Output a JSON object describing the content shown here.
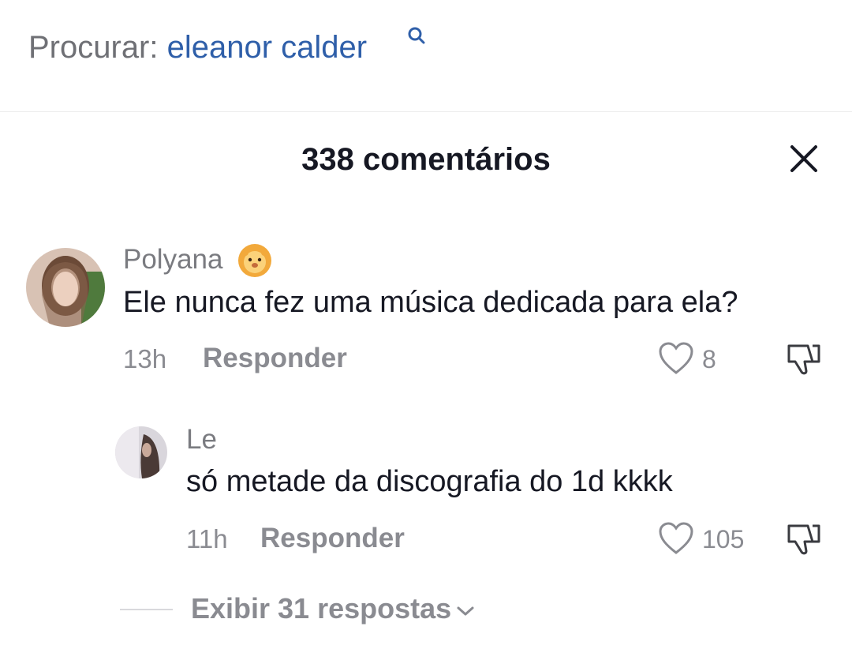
{
  "search": {
    "prefix": "Procurar: ",
    "query": "eleanor calder"
  },
  "comments_panel": {
    "title": "338 comentários"
  },
  "comments": [
    {
      "username": "Polyana",
      "emoji": "lion-face-icon",
      "text": "Ele nunca fez uma música dedicada para ela?",
      "time": "13h",
      "reply_label": "Responder",
      "likes": "8"
    }
  ],
  "replies": [
    {
      "username": "Le",
      "text": "só metade da discografia do 1d kkkk",
      "time": "11h",
      "reply_label": "Responder",
      "likes": "105"
    }
  ],
  "view_replies_label": "Exibir 31 respostas",
  "colors": {
    "search_query": "#2f5fa9",
    "muted_text": "#8a8b91",
    "primary_text": "#161823"
  }
}
